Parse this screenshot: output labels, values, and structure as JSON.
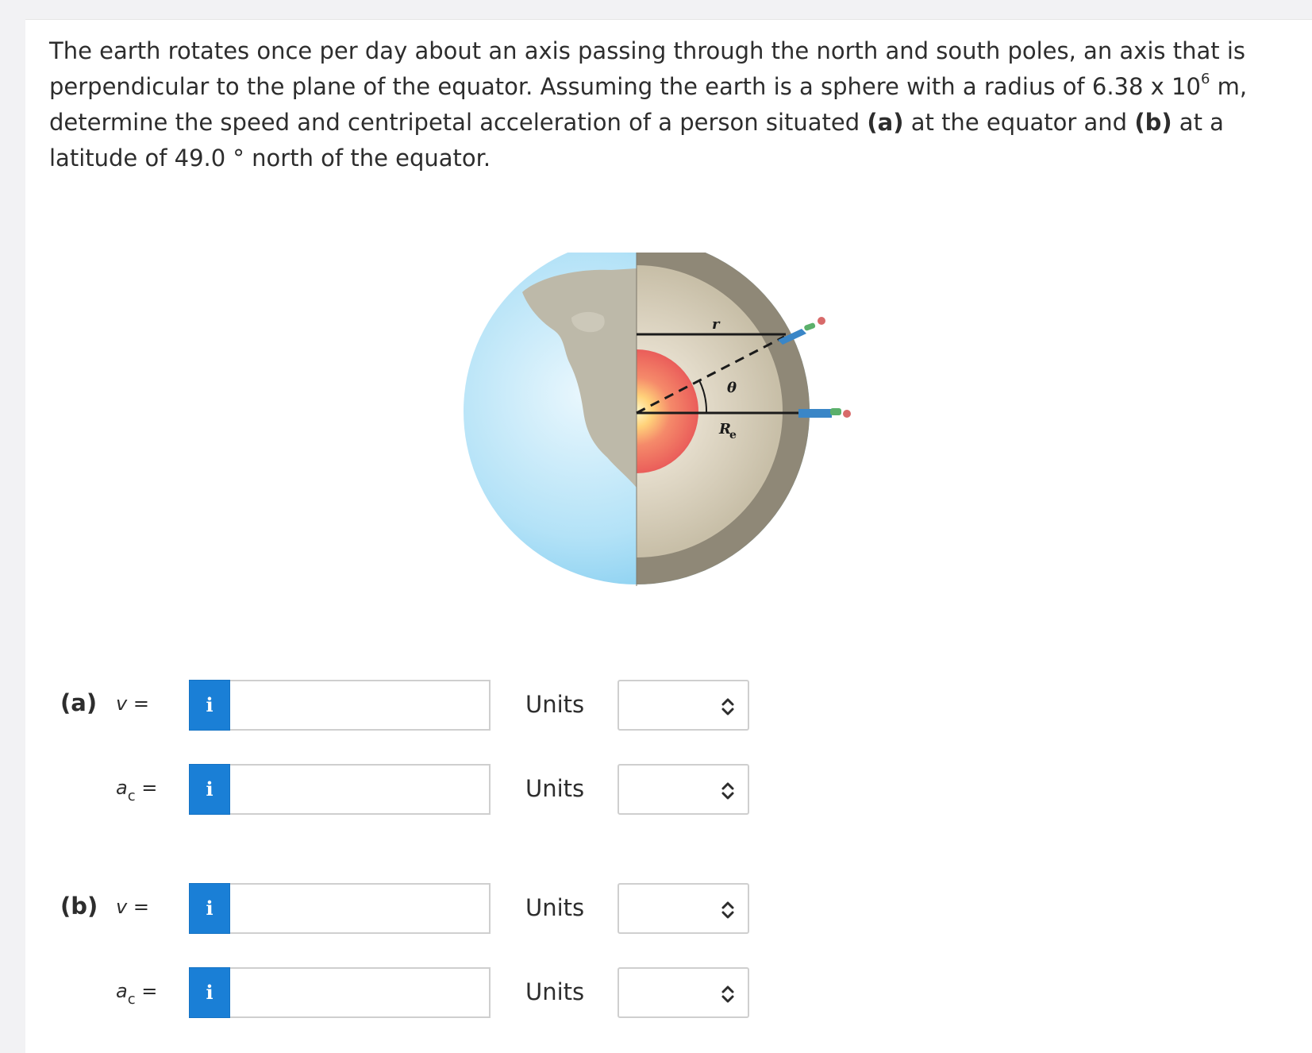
{
  "problem": {
    "text_1": "The earth rotates once per day about an axis passing through the north and south poles, an axis that is perpendicular to the plane of the equator. Assuming the earth is a sphere with a radius of 6.38 x 10",
    "exponent": "6",
    "text_2": " m, determine the speed and centripetal acceleration of a person situated ",
    "part_a_ref": "(a)",
    "text_3": " at the equator and ",
    "part_b_ref": "(b)",
    "text_4": " at a latitude of 49.0 ° north of the equator."
  },
  "figure": {
    "label_r": "r",
    "label_theta": "θ",
    "label_R": "R",
    "label_R_sub": "e"
  },
  "rows": [
    {
      "part": "(a)",
      "var": "v",
      "sub": "",
      "eq": " =",
      "value": "",
      "units_label": "Units",
      "info": "i"
    },
    {
      "part": "",
      "var": "a",
      "sub": "c",
      "eq": " =",
      "value": "",
      "units_label": "Units",
      "info": "i"
    },
    {
      "part": "(b)",
      "var": "v",
      "sub": "",
      "eq": " =",
      "value": "",
      "units_label": "Units",
      "info": "i"
    },
    {
      "part": "",
      "var": "a",
      "sub": "c",
      "eq": " =",
      "value": "",
      "units_label": "Units",
      "info": "i"
    }
  ],
  "icons": {
    "info": "info-icon",
    "select": "chevron-up-down-icon"
  },
  "colors": {
    "info_button": "#1a7fd6",
    "ocean": "#8fd0f0",
    "land": "#b9b6a8",
    "core": "#f07060"
  }
}
